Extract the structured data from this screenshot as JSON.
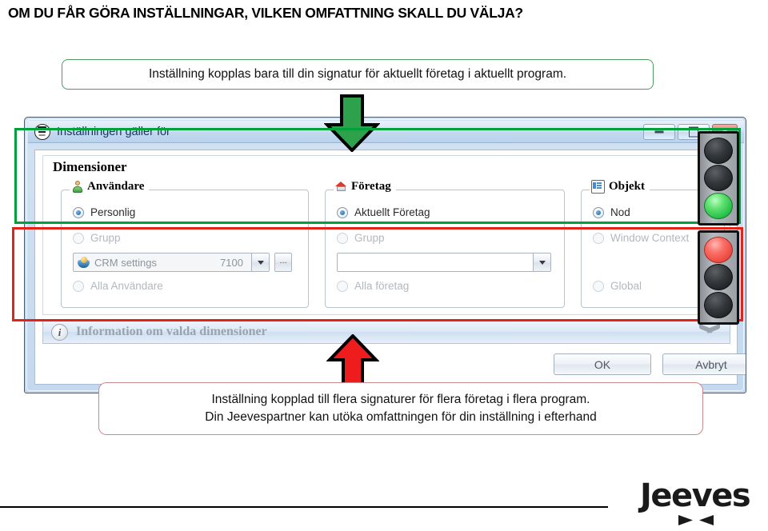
{
  "slide": {
    "heading": "OM DU FÅR GÖRA INSTÄLLNINGAR, VILKEN OMFATTNING SKALL DU VÄLJA?"
  },
  "callout_top": {
    "text": "Inställning kopplas bara till din signatur för aktuellt företag i aktuellt program.",
    "border_color": "#4f9a62"
  },
  "callout_bottom": {
    "line1": "Inställning kopplad till flera signaturer för flera företag i flera program.",
    "line2": "Din Jeevespartner kan utöka omfattningen för din inställning i efterhand",
    "border_color": "#c98a8e"
  },
  "arrows": {
    "down_label": "green-down-arrow",
    "down_color": "#2da14c",
    "up_label": "red-up-arrow",
    "up_color": "#ee1c1c"
  },
  "highlights": {
    "green_box_color": "#00a13a",
    "red_box_color": "#e2231a"
  },
  "window": {
    "title": "Inställningen gäller för",
    "icon": "jeeves-butler-icon",
    "controls": {
      "minimize": "–",
      "maximize": "□",
      "close": "✕"
    },
    "panel_title": "Dimensioner",
    "groups": [
      {
        "id": "anvandare",
        "legend": "Användare",
        "icon": "user-icon",
        "options": [
          {
            "label": "Personlig",
            "checked": true,
            "disabled": false
          },
          {
            "label": "Grupp",
            "checked": false,
            "disabled": true
          },
          {
            "label": "Alla Användare",
            "checked": false,
            "disabled": true
          }
        ],
        "combo": {
          "icon": "shield-icon",
          "text": "CRM settings",
          "number": "7100",
          "ellipsis": "..."
        }
      },
      {
        "id": "foretag",
        "legend": "Företag",
        "icon": "company-icon",
        "options": [
          {
            "label": "Aktuellt Företag",
            "checked": true,
            "disabled": false
          },
          {
            "label": "Grupp",
            "checked": false,
            "disabled": true
          },
          {
            "label": "Alla företag",
            "checked": false,
            "disabled": true
          }
        ],
        "combo": {
          "icon": "",
          "text": "",
          "number": "",
          "ellipsis": ""
        }
      },
      {
        "id": "objekt",
        "legend": "Objekt",
        "icon": "object-icon",
        "options": [
          {
            "label": "Nod",
            "checked": true,
            "disabled": false
          },
          {
            "label": "Window Context",
            "checked": false,
            "disabled": true
          },
          {
            "label": "Global",
            "checked": false,
            "disabled": true
          }
        ]
      }
    ],
    "info_bar": {
      "icon": "i",
      "text": "Information om valda dimensioner",
      "expander": "chevron-down-icon"
    },
    "buttons": {
      "ok": "OK",
      "cancel": "Avbryt"
    }
  },
  "traffic_lights": [
    {
      "id": "top",
      "lit": "green",
      "lamps": [
        "off",
        "off",
        "green"
      ]
    },
    {
      "id": "bottom",
      "lit": "red",
      "lamps": [
        "red",
        "off",
        "off"
      ]
    }
  ],
  "footer": {
    "logo_text": "Jeeves",
    "logo_mark": "bowtie-icon"
  }
}
